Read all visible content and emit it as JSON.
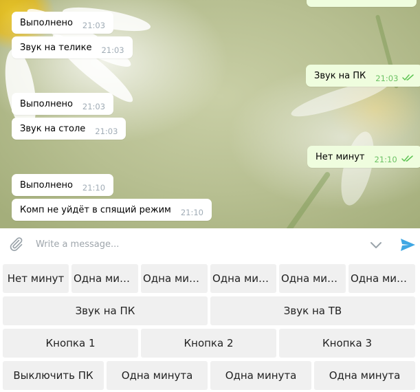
{
  "messages": [
    {
      "dir": "in",
      "text": "Выполнено",
      "time": "21:03"
    },
    {
      "dir": "in",
      "text": "Звук на телике",
      "time": "21:03"
    },
    {
      "dir": "out",
      "text": "Звук на ПК",
      "time": "21:03"
    },
    {
      "dir": "in",
      "text": "Выполнено",
      "time": "21:03"
    },
    {
      "dir": "in",
      "text": "Звук на столе",
      "time": "21:03"
    },
    {
      "dir": "out",
      "text": "Нет минут",
      "time": "21:10"
    },
    {
      "dir": "in",
      "text": "Выполнено",
      "time": "21:10"
    },
    {
      "dir": "in",
      "text": "Комп не уйдёт в спящий режим",
      "time": "21:10"
    }
  ],
  "composer": {
    "placeholder": "Write a message..."
  },
  "icons": {
    "attach": "paperclip-icon",
    "keyboard_toggle": "chevron-down-icon",
    "send": "send-arrow-icon",
    "read": "double-check-icon"
  },
  "colors": {
    "outgoing_bubble": "#effdde",
    "incoming_bubble": "#ffffff",
    "read_ticks": "#5dc452",
    "send_accent": "#40a7e3",
    "key_bg": "#f0f0f0"
  },
  "keyboard": {
    "rows": [
      [
        "Нет минут",
        "Одна минута",
        "Одна минута",
        "Одна минута",
        "Одна минута",
        "Одна минута"
      ],
      [
        "Звук на ПК",
        "Звук на ТВ"
      ],
      [
        "Кнопка 1",
        "Кнопка 2",
        "Кнопка 3"
      ],
      [
        "Выключить ПК",
        "Одна минута",
        "Одна минута",
        "Одна минута"
      ]
    ]
  }
}
